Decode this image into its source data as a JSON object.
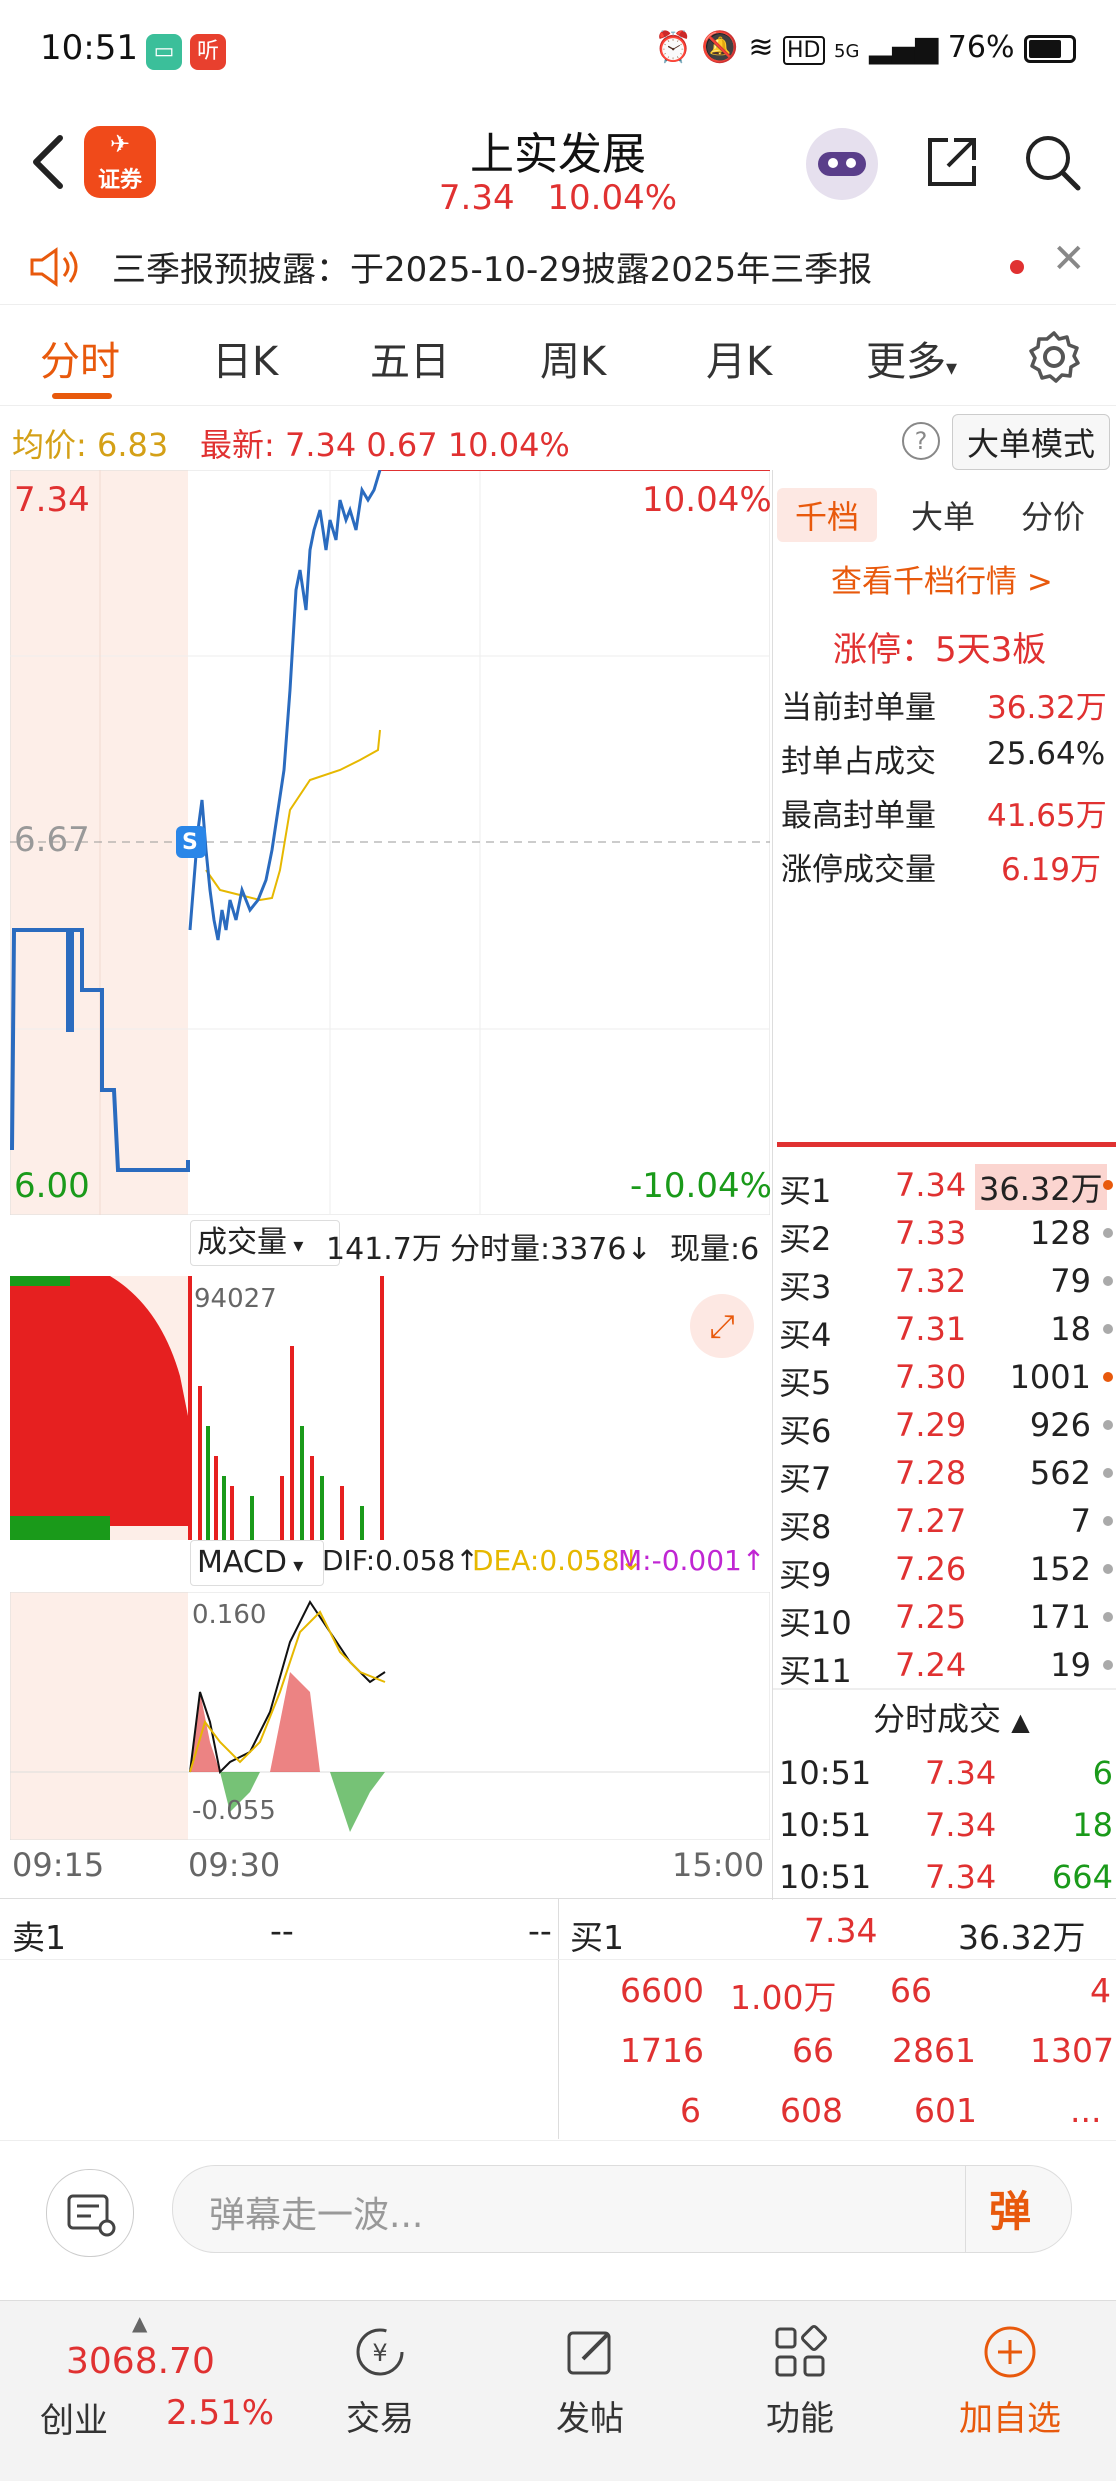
{
  "status_bar": {
    "time": "10:51",
    "battery": "76%",
    "network": "5G"
  },
  "header": {
    "logo_label": "证券",
    "title": "上实发展",
    "price": "7.34",
    "change_pct": "10.04%"
  },
  "notice": {
    "text": "三季报预披露：于2025-10-29披露2025年三季报"
  },
  "tabs": [
    "分时",
    "日K",
    "五日",
    "周K",
    "月K",
    "更多"
  ],
  "info_row": {
    "avg_label": "均价:",
    "avg_value": "6.83",
    "latest_label": "最新:",
    "latest_value": "7.34",
    "change": "0.67",
    "change_pct": "10.04%",
    "mode_button": "大单模式"
  },
  "main_chart": {
    "top_price": "7.34",
    "top_pct": "10.04%",
    "mid_price": "6.67",
    "bottom_price": "6.00",
    "bottom_pct": "-10.04%",
    "marker": "S"
  },
  "volume_panel": {
    "dropdown": "成交量",
    "total": "141.7万",
    "tick_label": "分时量:3376",
    "current_label": "现量:6",
    "peak_label": "94027"
  },
  "macd_panel": {
    "dropdown": "MACD",
    "dif": "DIF:0.058",
    "dea": "DEA:0.058",
    "m": "M:-0.001",
    "top_label": "0.160",
    "bottom_label": "-0.055"
  },
  "time_axis": [
    "09:15",
    "09:30",
    "15:00"
  ],
  "right_panel": {
    "tabs": [
      "千档",
      "大单",
      "分价"
    ],
    "link": "查看千档行情 >",
    "limit_up": "涨停：5天3板",
    "stats": [
      {
        "label": "当前封单量",
        "value": "36.32万"
      },
      {
        "label": "封单占成交",
        "value": "25.64%"
      },
      {
        "label": "最高封单量",
        "value": "41.65万"
      },
      {
        "label": "涨停成交量",
        "value": "6.19万"
      }
    ],
    "bids": [
      {
        "label": "买1",
        "price": "7.34",
        "vol": "36.32万"
      },
      {
        "label": "买2",
        "price": "7.33",
        "vol": "128"
      },
      {
        "label": "买3",
        "price": "7.32",
        "vol": "79"
      },
      {
        "label": "买4",
        "price": "7.31",
        "vol": "18"
      },
      {
        "label": "买5",
        "price": "7.30",
        "vol": "1001"
      },
      {
        "label": "买6",
        "price": "7.29",
        "vol": "926"
      },
      {
        "label": "买7",
        "price": "7.28",
        "vol": "562"
      },
      {
        "label": "买8",
        "price": "7.27",
        "vol": "7"
      },
      {
        "label": "买9",
        "price": "7.26",
        "vol": "152"
      },
      {
        "label": "买10",
        "price": "7.25",
        "vol": "171"
      },
      {
        "label": "买11",
        "price": "7.24",
        "vol": "19"
      }
    ],
    "ticks_header": "分时成交",
    "ticks": [
      {
        "time": "10:51",
        "price": "7.34",
        "vol": "6"
      },
      {
        "time": "10:51",
        "price": "7.34",
        "vol": "18"
      },
      {
        "time": "10:51",
        "price": "7.34",
        "vol": "664"
      }
    ]
  },
  "order_table": {
    "sell_label": "卖1",
    "sell_price": "--",
    "sell_vol": "--",
    "buy_label": "买1",
    "buy_price": "7.34",
    "buy_vol": "36.32万",
    "rows": [
      [
        "6600",
        "1.00万",
        "66",
        "4"
      ],
      [
        "1716",
        "66",
        "2861",
        "1307"
      ],
      [
        "6",
        "608",
        "601",
        "..."
      ]
    ]
  },
  "comment": {
    "placeholder": "弹幕走一波...",
    "danmu_label": "弹"
  },
  "bottom_nav": {
    "index_value": "3068.70",
    "index_name": "创业",
    "index_pct": "2.51%",
    "items": [
      "交易",
      "发帖",
      "功能",
      "加自选"
    ]
  }
}
